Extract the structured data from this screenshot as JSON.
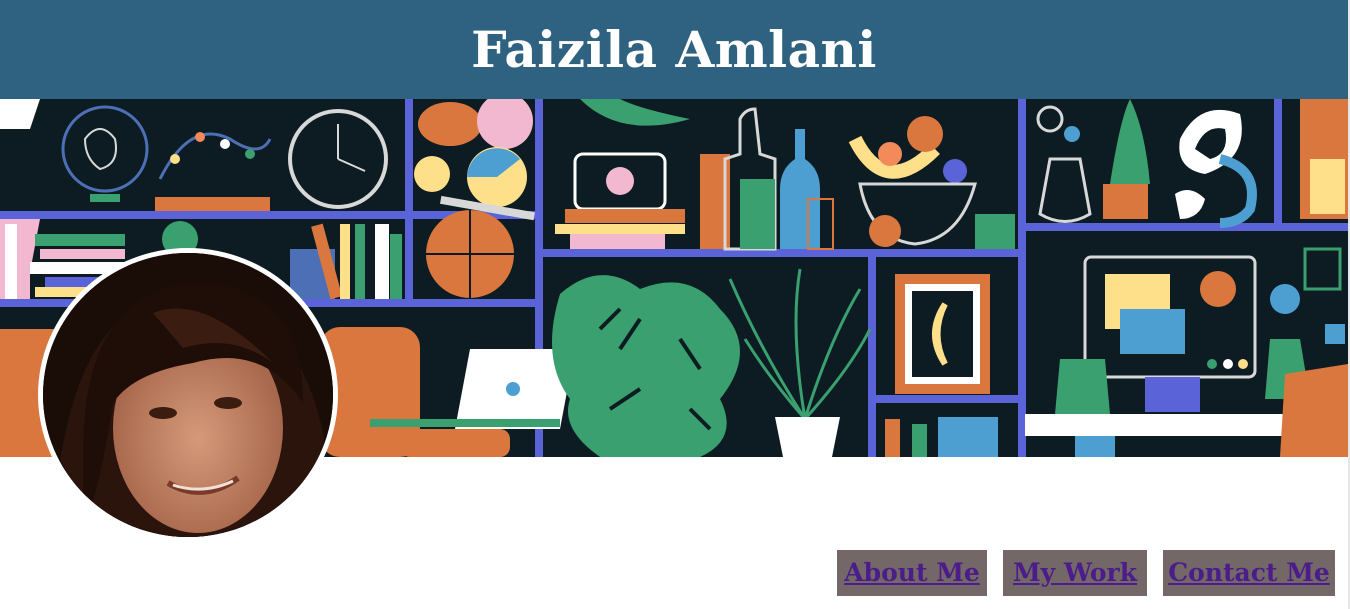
{
  "header": {
    "title": "Faizila Amlani"
  },
  "banner": {
    "description_icon": "illustrated-shelves-image"
  },
  "profile": {
    "avatar_icon": "profile-photo"
  },
  "nav": {
    "items": [
      {
        "label": "About Me"
      },
      {
        "label": "My Work"
      },
      {
        "label": "Contact Me"
      }
    ]
  },
  "colors": {
    "header_bg": "#2e6280",
    "nav_bg": "#736867",
    "nav_text": "#4b1c8a",
    "banner_bg": "#0d1c22",
    "shelf": "#5a63d8"
  }
}
